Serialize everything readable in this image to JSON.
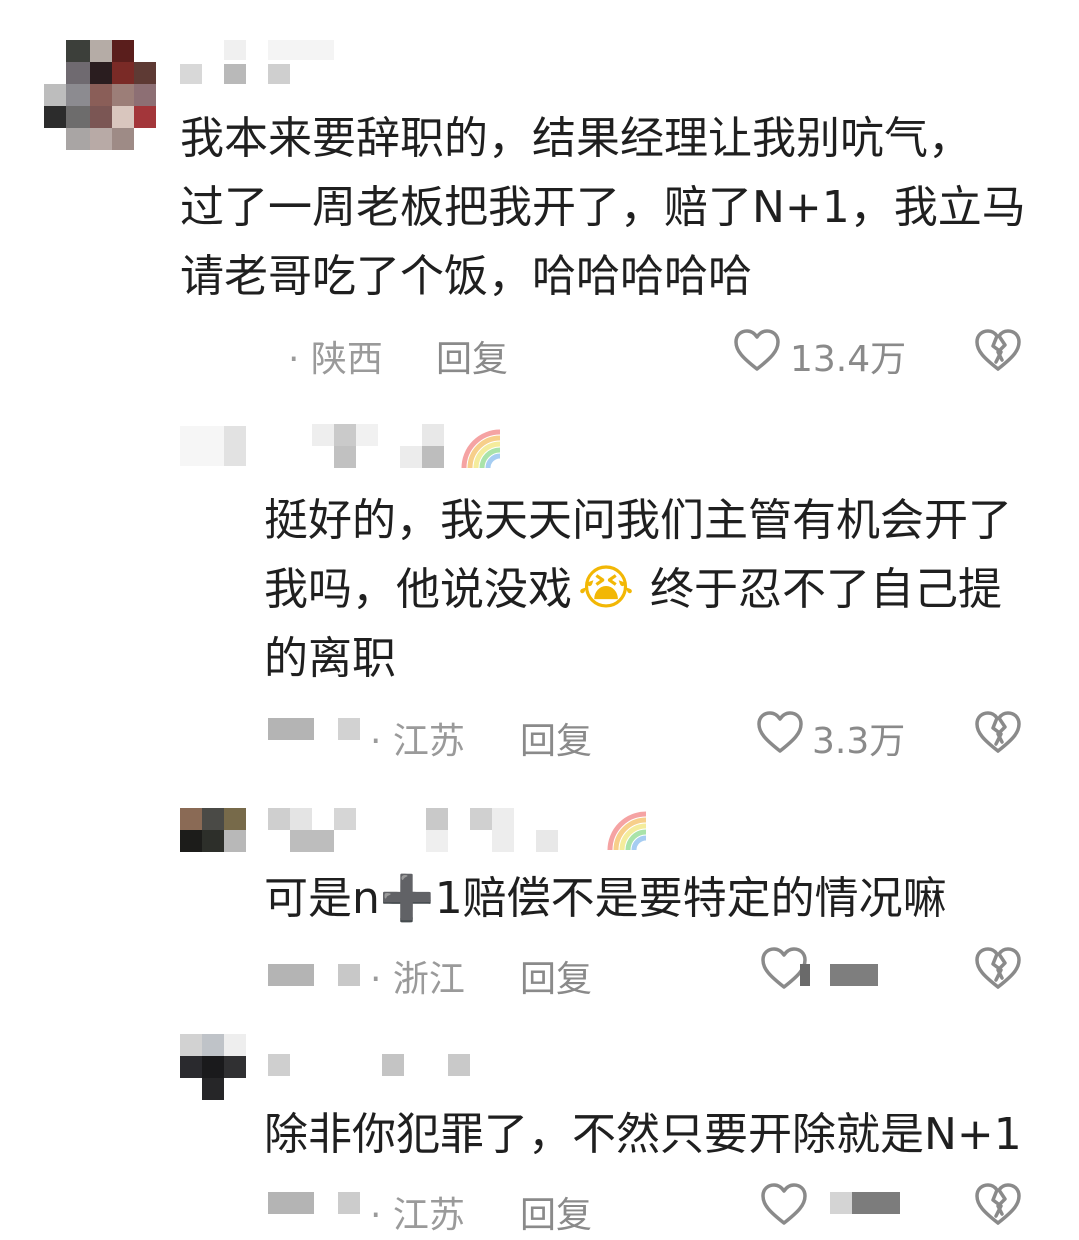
{
  "comments": [
    {
      "text_lines": [
        "我本来要辞职的，结果经理让我别吭气，",
        "过了一周老板把我开了，赔了N+1，我立马",
        "请老哥吃了个饭，哈哈哈哈哈"
      ],
      "location": "· 陕西",
      "reply_label": "回复",
      "likes": "13.4万"
    },
    {
      "text_lines": [
        "挺好的，我天天问我们主管有机会开了",
        "我吗，他说没戏",
        "终于忍不了自己提",
        "的离职"
      ],
      "emoji": "😭",
      "location": "· 江苏",
      "reply_label": "回复",
      "likes": "3.3万"
    },
    {
      "text_before": "可是n",
      "plus_icon": "➕",
      "text_after": "1赔偿不是要特定的情况嘛",
      "location": "· 浙江",
      "reply_label": "回复"
    },
    {
      "text_lines": [
        "除非你犯罪了，不然只要开除就是N+1"
      ],
      "location": "· 江苏",
      "reply_label": "回复"
    }
  ],
  "colors": {
    "text": "#1f1f1f",
    "meta": "#9a9a9a",
    "icon": "#8a8a8a",
    "background": "#ffffff"
  }
}
